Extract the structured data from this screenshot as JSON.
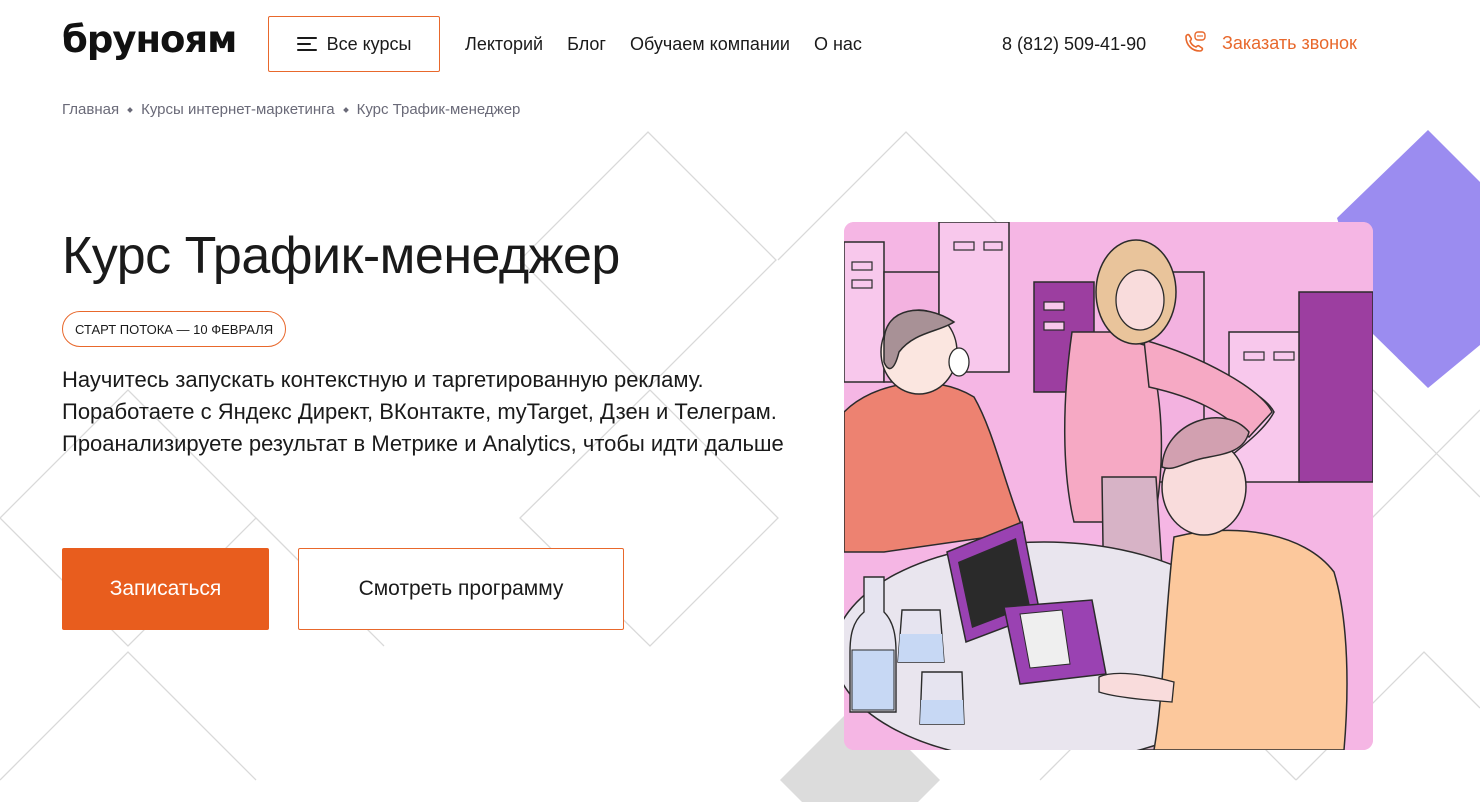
{
  "header": {
    "logo": "бруноям",
    "all_courses_label": "Все курсы",
    "nav": [
      "Лекторий",
      "Блог",
      "Обучаем компании",
      "О нас"
    ],
    "phone": "8 (812) 509-41-90",
    "callback_label": "Заказать звонок"
  },
  "breadcrumb": [
    "Главная",
    "Курсы интернет-маркетинга",
    "Курс Трафик-менеджер"
  ],
  "hero": {
    "title": "Курс Трафик-менеджер",
    "badge": "СТАРТ ПОТОКА — 10 ФЕВРАЛЯ",
    "description": "Научитесь запускать контекстную и таргетированную рекламу. Поработаете с Яндекс Директ, ВКонтакте, myTarget, Дзен и Телеграм. Проанализируете результат в Метрике и Analytics, чтобы идти дальше",
    "primary_button": "Записаться",
    "secondary_button": "Смотреть программу"
  },
  "colors": {
    "accent": "#e85d1e",
    "accent_border": "#e8682c",
    "decor_purple": "#9b8cf0",
    "illustration_bg": "#f5b6e4"
  },
  "icons": {
    "menu": "burger-menu-icon",
    "callback": "phone-chat-icon"
  }
}
